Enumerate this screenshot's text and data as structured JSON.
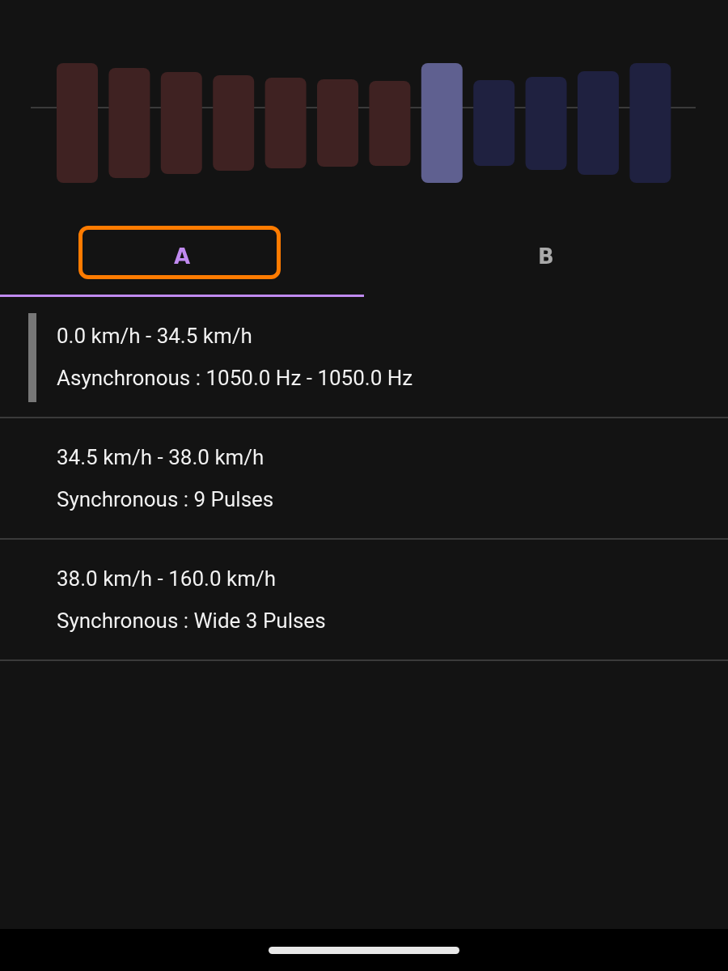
{
  "tabs": [
    {
      "label": "A",
      "selected": true,
      "focused": true
    },
    {
      "label": "B",
      "selected": false,
      "focused": false
    }
  ],
  "items": [
    {
      "speed_range": "0.0 km/h - 34.5 km/h",
      "mode": "Asynchronous : 1050.0 Hz - 1050.0 Hz",
      "active": true
    },
    {
      "speed_range": "34.5 km/h - 38.0 km/h",
      "mode": "Synchronous : 9 Pulses",
      "active": false
    },
    {
      "speed_range": "38.0 km/h - 160.0 km/h",
      "mode": "Synchronous : Wide 3 Pulses",
      "active": false
    }
  ]
}
